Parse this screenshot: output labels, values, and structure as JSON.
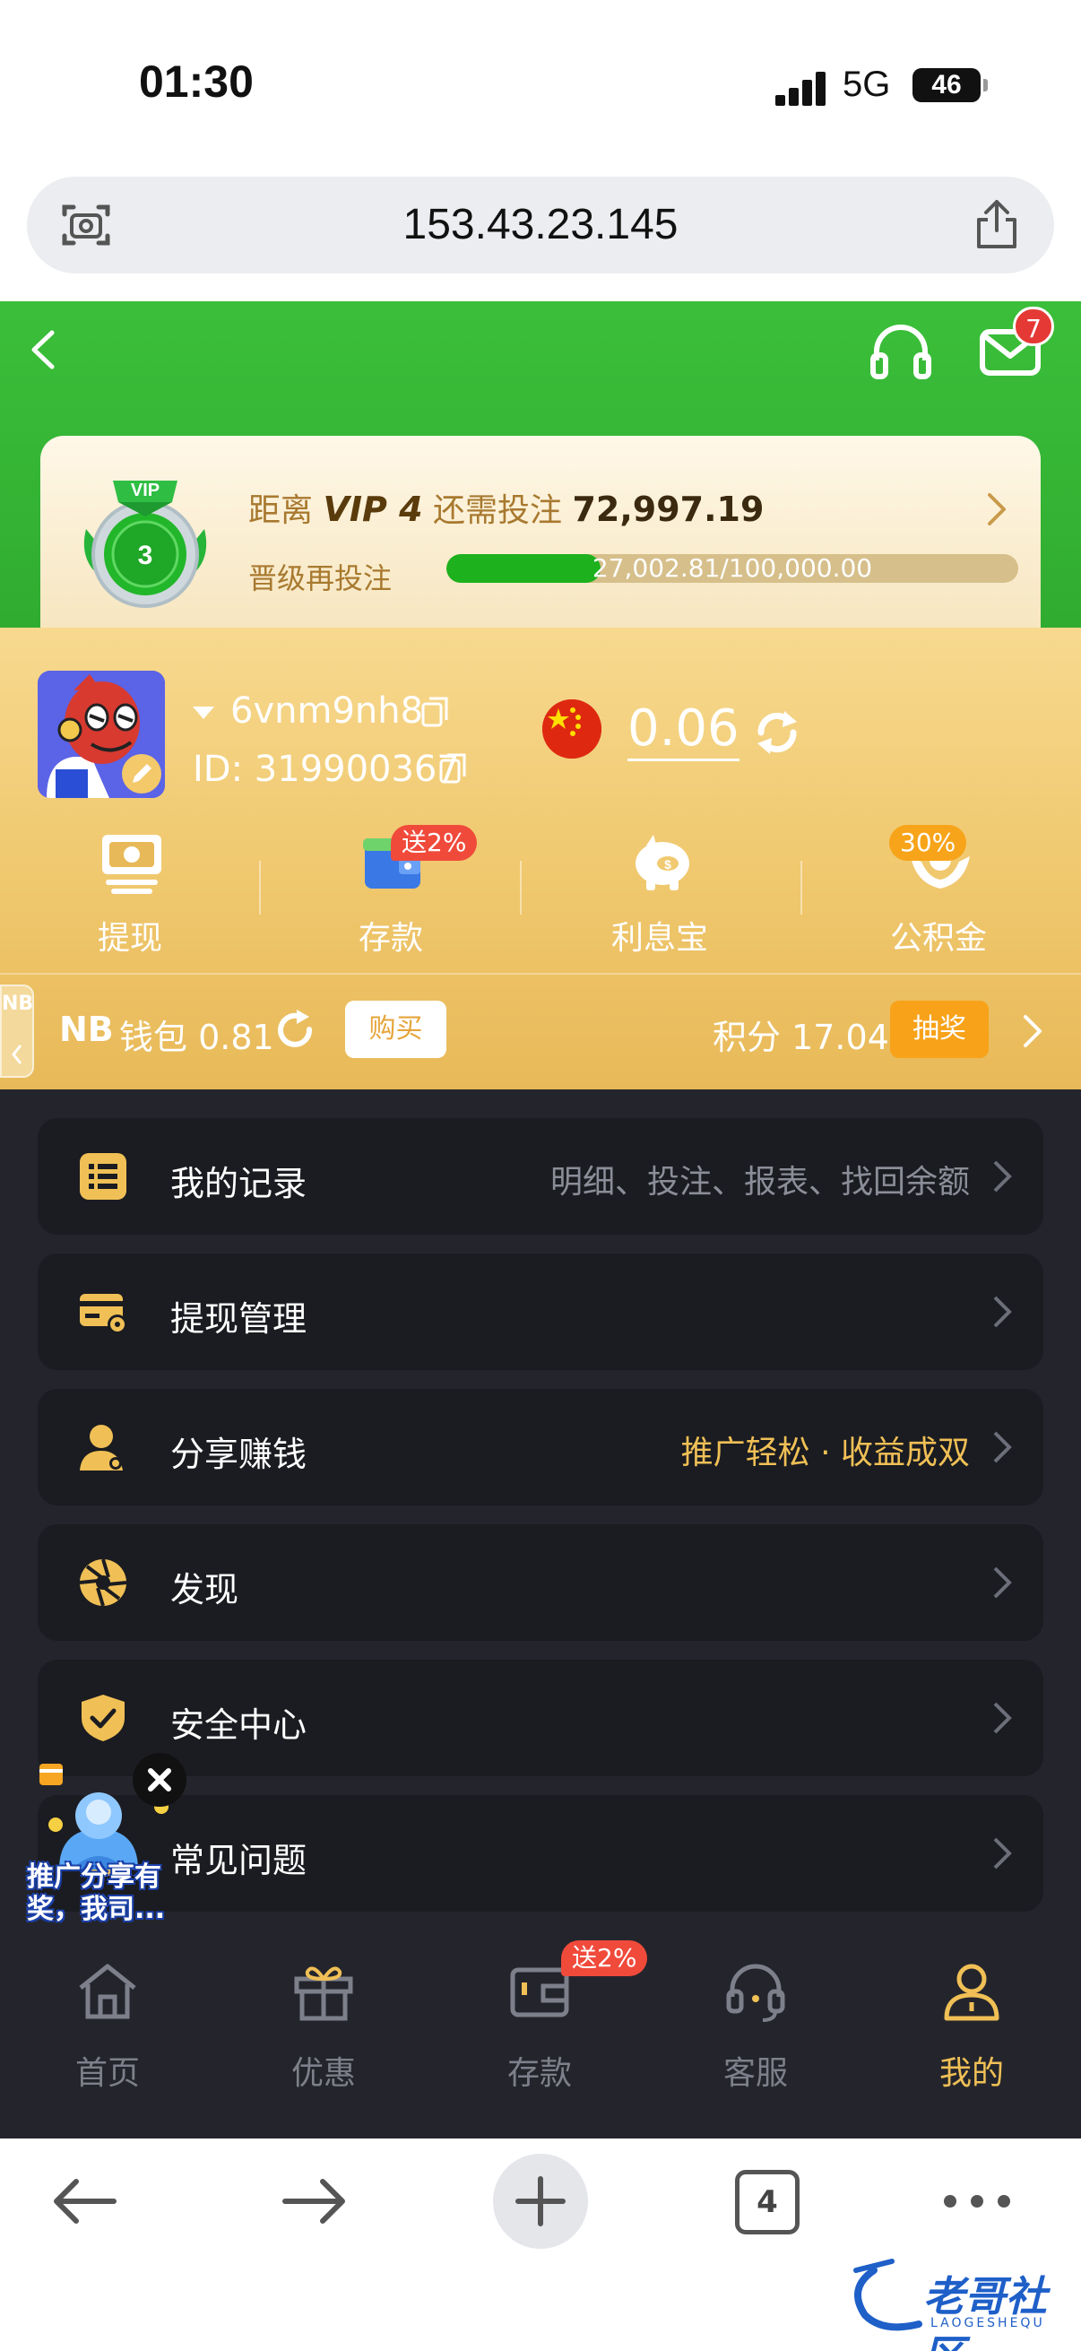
{
  "status_bar": {
    "time": "01:30",
    "network": "5G",
    "battery": "46"
  },
  "browser": {
    "url": "153.43.23.145",
    "tab_count": "4"
  },
  "header": {
    "mail_badge": "7"
  },
  "vip": {
    "prefix": "距离",
    "level_name": "VIP 4",
    "mid": "还需投注",
    "amount": "72,997.19",
    "medal_level": "3",
    "medal_ribbon": "VIP",
    "progress_label": "晋级再投注",
    "progress_text": "27,002.81/100,000.00",
    "progress_fraction": 0.27
  },
  "user": {
    "name": "6vnm9nh8",
    "id": "ID: 319900367",
    "balance": "0.06"
  },
  "features": [
    {
      "label": "提现",
      "icon": "withdraw-icon"
    },
    {
      "label": "存款",
      "icon": "wallet-icon",
      "promo": "送2%"
    },
    {
      "label": "利息宝",
      "icon": "piggy-bank-icon"
    },
    {
      "label": "公积金",
      "icon": "hands-icon",
      "promo": "30%"
    }
  ],
  "wallet": {
    "side_tab": "NB",
    "logo": "NB",
    "label": "钱包 0.81",
    "buy": "购买",
    "points": "积分 17.04",
    "lottery": "抽奖"
  },
  "menu": [
    {
      "title": "我的记录",
      "subtitle": "明细、投注、报表、找回余额",
      "icon": "records-icon"
    },
    {
      "title": "提现管理",
      "subtitle": "",
      "icon": "card-settings-icon"
    },
    {
      "title": "分享赚钱",
      "subtitle": "推广轻松 · 收益成双",
      "icon": "share-user-icon"
    },
    {
      "title": "发现",
      "subtitle": "",
      "icon": "aperture-icon"
    },
    {
      "title": "安全中心",
      "subtitle": "",
      "icon": "shield-icon"
    },
    {
      "title": "常见问题",
      "subtitle": "",
      "icon": "question-icon"
    }
  ],
  "floating_promo": {
    "text": "推广分享有奖，我司..."
  },
  "tabs": [
    {
      "label": "首页",
      "icon": "home-icon"
    },
    {
      "label": "优惠",
      "icon": "gift-icon"
    },
    {
      "label": "存款",
      "icon": "wallet-icon",
      "promo": "送2%"
    },
    {
      "label": "客服",
      "icon": "headset-icon"
    },
    {
      "label": "我的",
      "icon": "user-icon",
      "active": true
    }
  ],
  "watermark": {
    "text": "老哥社区",
    "sub": "LAOGESHEQU"
  },
  "colors": {
    "green": "#2faa2f",
    "gold": "#f0c970",
    "dark": "#24252c",
    "accent": "#f0c056",
    "red": "#f04a3b"
  }
}
